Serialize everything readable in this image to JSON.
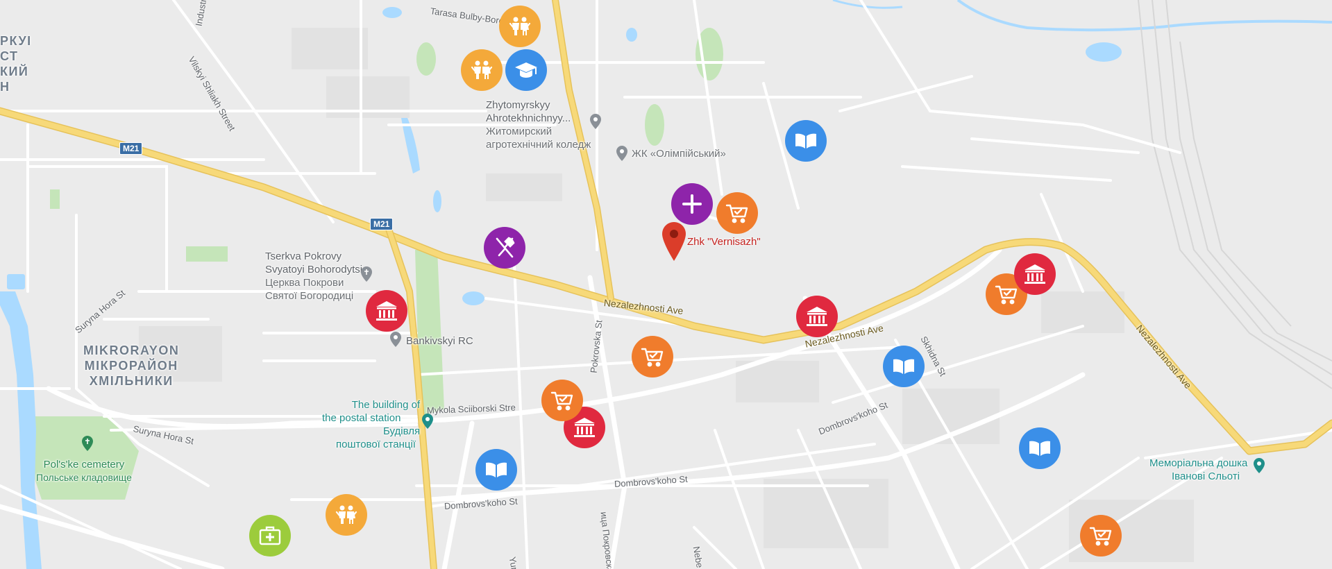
{
  "map": {
    "highway_shields": [
      "M21",
      "M21"
    ],
    "streets": {
      "tarasa": "Tarasa Bulby-Borov",
      "industr": "Industri",
      "vilskyi": "Vilskyi Shliakh Street",
      "nez1": "Nezalezhnosti Ave",
      "nez2": "Nezalezhnosti Ave",
      "nez3": "Nezalezhnosti Ave",
      "pokrovska": "Pokrovska St",
      "pokrovskaya_cyr": "ица Покровская",
      "suryna1": "Suryna Hora St",
      "suryna2": "Suryna Hora St",
      "mykola": "Mykola Sciiborski Stre",
      "dombr1": "Dombrovs'koho St",
      "dombr2": "Dombrovs'koho St",
      "dombr3": "Dombrovs'koho St",
      "skhidna": "Skhidna St",
      "yurk": "Yurk",
      "nebe": "Nebe"
    },
    "places": {
      "zhytomyr": [
        "Zhytomyrskyy",
        "Ahrotekhnichnyy...",
        "Житомирский",
        "агротехнічний коледж"
      ],
      "olimp": "ЖК «Олімпійський»",
      "tserkva": [
        "Tserkva Pokrovy",
        "Svyatoyi Bohorodytsi",
        "Церква Покрови",
        "Святої Богородиці"
      ],
      "bankivskyi": "Bankivskyi RC",
      "postal": [
        "The building of",
        "the postal station",
        "Будівля",
        "поштової станції"
      ],
      "cemetery": [
        "Pol's'ke cemetery",
        "Польське кладовище"
      ],
      "memorial": [
        "Меморіальна дошка",
        "Івановi Сльоті"
      ],
      "district": [
        "MIKRORAYON",
        "МІКРОРАЙОН",
        "ХМІЛЬНИКИ"
      ],
      "district_topleft": [
        "РКУІ",
        "СТ",
        "КИЙ",
        "Н"
      ]
    },
    "selected_pin": "Zhk \"Vernisazh\""
  },
  "markers": [
    {
      "id": "m1",
      "type": "kids",
      "icon": "children-icon",
      "color": "#f4a93a"
    },
    {
      "id": "m2",
      "type": "kids",
      "icon": "children-icon",
      "color": "#f4a93a"
    },
    {
      "id": "m3",
      "type": "education",
      "icon": "graduation-cap-icon",
      "color": "#3b8fe8"
    },
    {
      "id": "m4",
      "type": "library",
      "icon": "book-icon",
      "color": "#3b8fe8"
    },
    {
      "id": "m5",
      "type": "medical",
      "icon": "plus-icon",
      "color": "#8e24aa"
    },
    {
      "id": "m6",
      "type": "shop",
      "icon": "cart-icon",
      "color": "#f07c2c"
    },
    {
      "id": "m7",
      "type": "restaurant",
      "icon": "fork-knife-icon",
      "color": "#8e24aa"
    },
    {
      "id": "m8",
      "type": "bank",
      "icon": "bank-icon",
      "color": "#e0293f"
    },
    {
      "id": "m9",
      "type": "shop",
      "icon": "cart-icon",
      "color": "#f07c2c"
    },
    {
      "id": "m10",
      "type": "bank",
      "icon": "bank-icon",
      "color": "#e0293f"
    },
    {
      "id": "m11",
      "type": "shop",
      "icon": "cart-icon",
      "color": "#f07c2c"
    },
    {
      "id": "m12",
      "type": "bank",
      "icon": "bank-icon",
      "color": "#e0293f"
    },
    {
      "id": "m13",
      "type": "library",
      "icon": "book-icon",
      "color": "#3b8fe8"
    },
    {
      "id": "m14",
      "type": "bank",
      "icon": "bank-icon",
      "color": "#e0293f"
    },
    {
      "id": "m15",
      "type": "shop",
      "icon": "cart-icon",
      "color": "#f07c2c"
    },
    {
      "id": "m16",
      "type": "library",
      "icon": "book-icon",
      "color": "#3b8fe8"
    },
    {
      "id": "m17",
      "type": "library",
      "icon": "book-icon",
      "color": "#3b8fe8"
    },
    {
      "id": "m18",
      "type": "kids",
      "icon": "children-icon",
      "color": "#f4a93a"
    },
    {
      "id": "m19",
      "type": "pharmacy",
      "icon": "first-aid-icon",
      "color": "#9ccc3c"
    },
    {
      "id": "m20",
      "type": "shop",
      "icon": "cart-icon",
      "color": "#f07c2c"
    }
  ],
  "colors": {
    "background": "#ebebeb",
    "road": "#ffffff",
    "highway": "#f7d979",
    "highway_edge": "#e6c25a",
    "water": "#aadaff",
    "park": "#c5e5b9",
    "block": "#dedede"
  }
}
